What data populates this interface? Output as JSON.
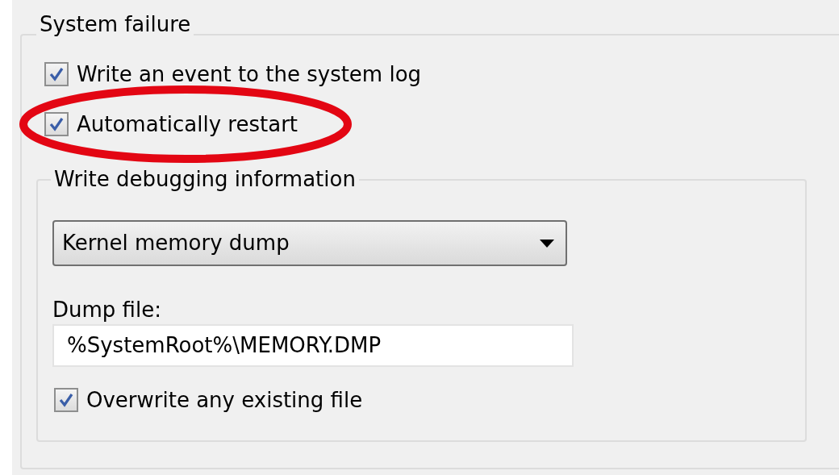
{
  "group": {
    "title": "System failure",
    "checkboxes": [
      {
        "label": "Write an event to the system log",
        "checked": true,
        "highlighted": false
      },
      {
        "label": "Automatically restart",
        "checked": true,
        "highlighted": true
      }
    ],
    "debug_group": {
      "title": "Write debugging information",
      "dropdown": {
        "value": "Kernel memory dump"
      },
      "dump_file": {
        "label": "Dump file:",
        "value": "%SystemRoot%\\MEMORY.DMP"
      },
      "overwrite": {
        "label": "Overwrite any existing file",
        "checked": true
      }
    }
  }
}
